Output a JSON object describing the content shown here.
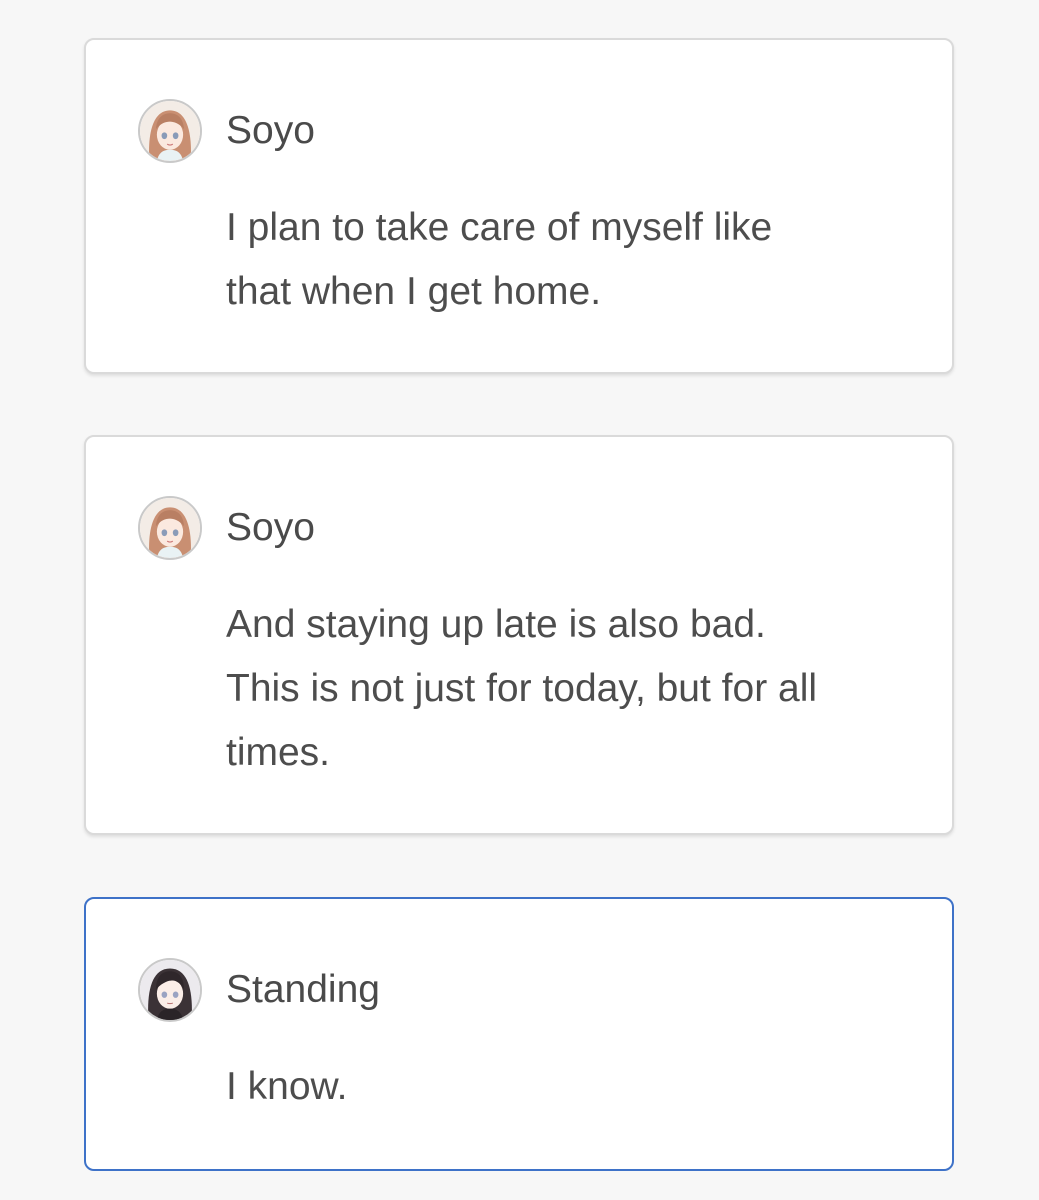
{
  "messages": [
    {
      "speaker": "Soyo",
      "avatar_icon": "soyo-avatar-icon",
      "lines": [
        "I plan to take care of myself like",
        "that when I get home."
      ],
      "selected": false
    },
    {
      "speaker": "Soyo",
      "avatar_icon": "soyo-avatar-icon",
      "lines": [
        "And staying up late is also bad.",
        "This is not just for today, but for all",
        "times."
      ],
      "selected": false
    },
    {
      "speaker": "Standing",
      "avatar_icon": "standing-avatar-icon",
      "lines": [
        "I know."
      ],
      "selected": true
    }
  ],
  "colors": {
    "background": "#f7f7f7",
    "card": "#ffffff",
    "card_border": "#dadada",
    "selected_border": "#3e72c8",
    "text": "#4d4d4d",
    "soyo_hair": "#c98f72",
    "standing_hair": "#3b3236"
  }
}
